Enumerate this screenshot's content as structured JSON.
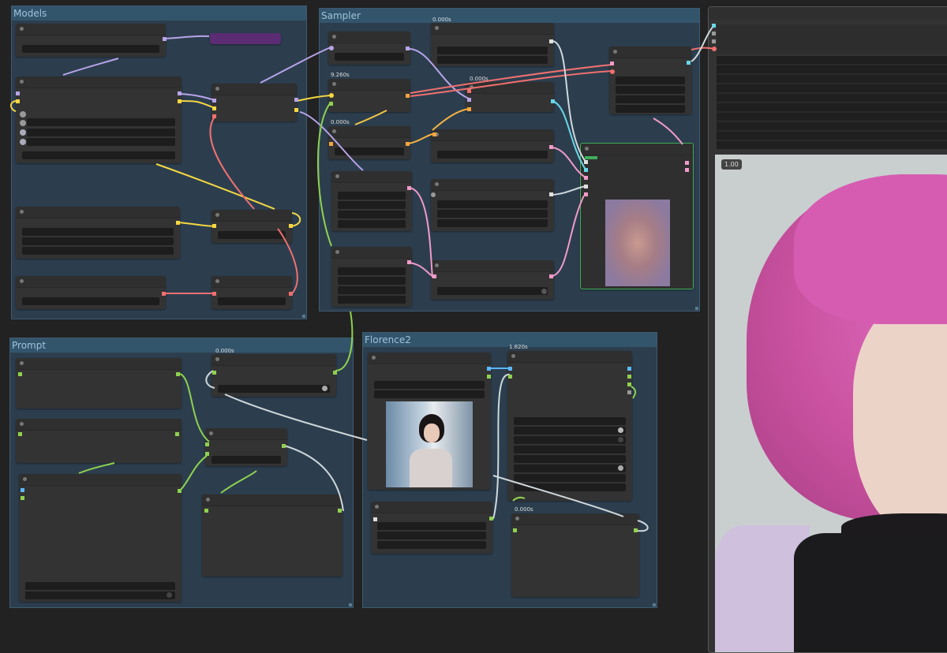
{
  "groups": {
    "models": "Models",
    "sampler": "Sampler",
    "prompt": "Prompt",
    "florence": "Florence2"
  },
  "timings": {
    "t1": "0.000s",
    "t2": "9.260s",
    "t3": "0.000s",
    "t4": "0.000s",
    "t5": "0.000s",
    "t6": "1.820s",
    "t7": "0.000s"
  },
  "preview": {
    "counter": "1.00"
  },
  "colors": {
    "bg": "#222222",
    "group": "#2c3e4e",
    "node": "#333333",
    "wire_yellow": "#f5d742",
    "wire_purple": "#b8a4e8",
    "wire_red": "#f07070",
    "wire_pink": "#f09ac8",
    "wire_green": "#8fd14f",
    "wire_cyan": "#68d8e8",
    "wire_white": "#cfd8dc",
    "highlight_node_border": "#3fae5a"
  }
}
